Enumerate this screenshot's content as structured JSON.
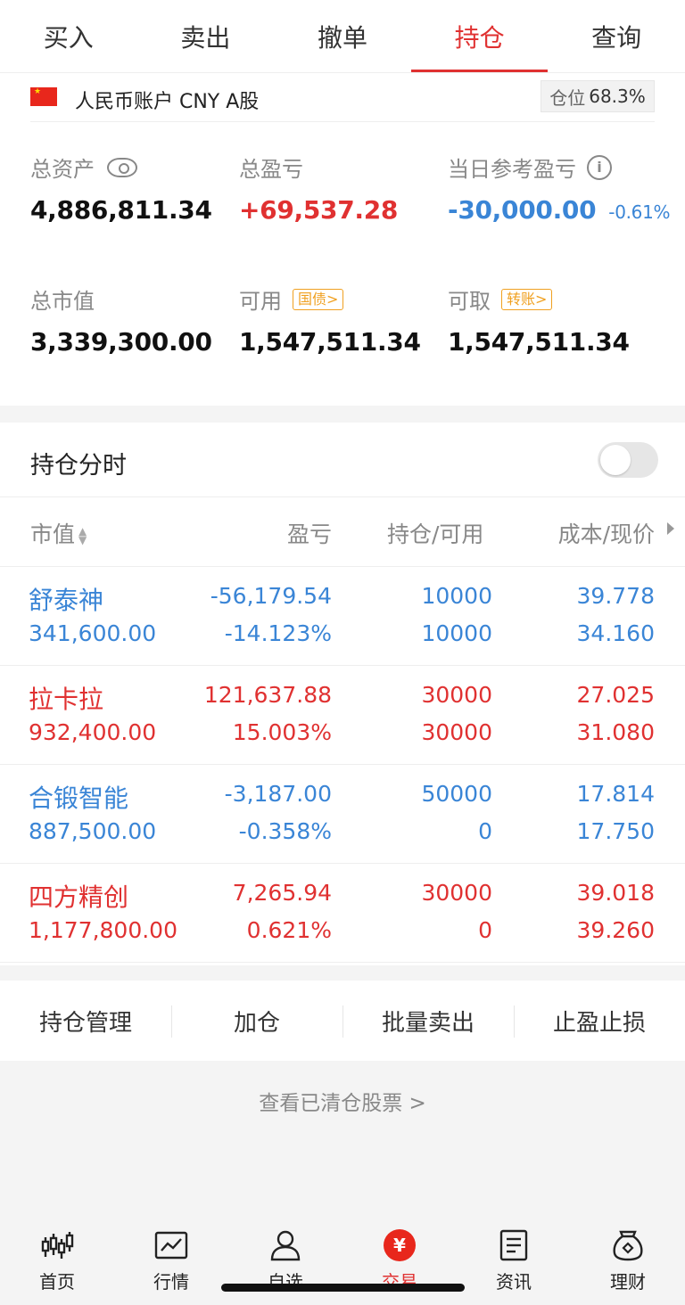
{
  "tabs": [
    {
      "label": "买入"
    },
    {
      "label": "卖出"
    },
    {
      "label": "撤单"
    },
    {
      "label": "持仓"
    },
    {
      "label": "查询"
    }
  ],
  "active_tab": "持仓",
  "account": {
    "label": "人民币账户 CNY A股",
    "position_key": "仓位",
    "position_value": "68.3%"
  },
  "stats": {
    "total_assets": {
      "label": "总资产",
      "value": "4,886,811.34"
    },
    "total_pnl": {
      "label": "总盈亏",
      "value": "+69,537.28"
    },
    "daily_pnl": {
      "label": "当日参考盈亏",
      "value": "-30,000.00",
      "pct": "-0.61%"
    },
    "market_value": {
      "label": "总市值",
      "value": "3,339,300.00"
    },
    "available": {
      "label": "可用",
      "tag": "国债>",
      "value": "1,547,511.34"
    },
    "withdrawable": {
      "label": "可取",
      "tag": "转账>",
      "value": "1,547,511.34"
    }
  },
  "holdings_timeshare": {
    "label": "持仓分时",
    "enabled": false
  },
  "table": {
    "headers": {
      "market_value": "市值",
      "pnl": "盈亏",
      "position": "持仓/可用",
      "cost_price": "成本/现价"
    },
    "rows": [
      {
        "name": "舒泰神",
        "mv": "341,600.00",
        "pnl": "-56,179.54",
        "pnl_pct": "-14.123%",
        "hold": "10000",
        "avail": "10000",
        "cost": "39.778",
        "price": "34.160",
        "color": "#3a85d6"
      },
      {
        "name": "拉卡拉",
        "mv": "932,400.00",
        "pnl": "121,637.88",
        "pnl_pct": "15.003%",
        "hold": "30000",
        "avail": "30000",
        "cost": "27.025",
        "price": "31.080",
        "color": "#e03131"
      },
      {
        "name": "合锻智能",
        "mv": "887,500.00",
        "pnl": "-3,187.00",
        "pnl_pct": "-0.358%",
        "hold": "50000",
        "avail": "0",
        "cost": "17.814",
        "price": "17.750",
        "color": "#3a85d6"
      },
      {
        "name": "四方精创",
        "mv": "1,177,800.00",
        "pnl": "7,265.94",
        "pnl_pct": "0.621%",
        "hold": "30000",
        "avail": "0",
        "cost": "39.018",
        "price": "39.260",
        "color": "#e03131"
      }
    ]
  },
  "actions": [
    {
      "label": "持仓管理"
    },
    {
      "label": "加仓"
    },
    {
      "label": "批量卖出"
    },
    {
      "label": "止盈止损"
    }
  ],
  "cleared_link": "查看已清仓股票 >",
  "bottom_nav": [
    {
      "label": "首页",
      "icon": "candlestick-icon"
    },
    {
      "label": "行情",
      "icon": "chart-icon"
    },
    {
      "label": "自选",
      "icon": "user-icon"
    },
    {
      "label": "交易",
      "icon": "yuan-icon"
    },
    {
      "label": "资讯",
      "icon": "document-icon"
    },
    {
      "label": "理财",
      "icon": "money-bag-icon"
    }
  ],
  "yuan_symbol": "¥",
  "flag_star": "★",
  "colors": {
    "red": "#e03131",
    "blue": "#3a85d6",
    "orange": "#f0a020"
  }
}
